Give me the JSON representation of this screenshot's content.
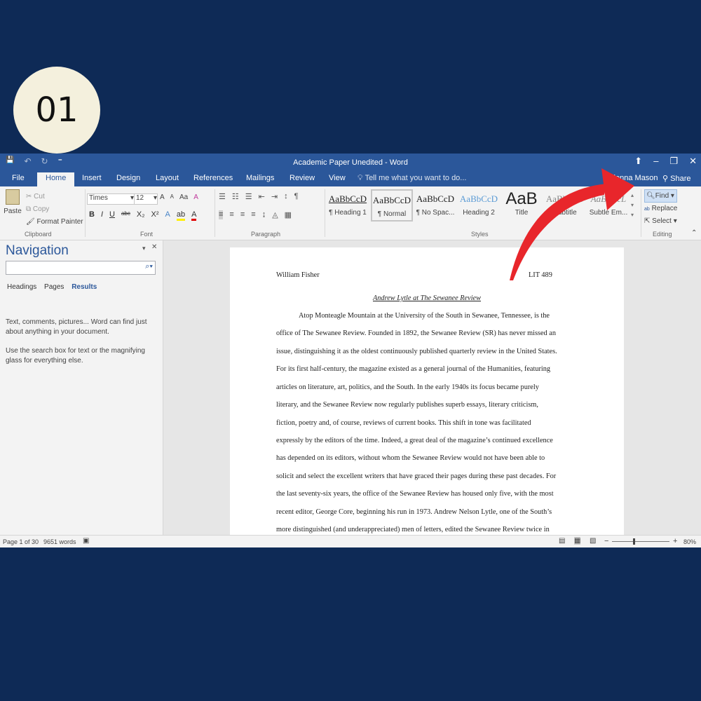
{
  "badge": "01",
  "window": {
    "title": "Academic Paper Unedited - Word",
    "min": "–",
    "restore": "❐",
    "close": "✕",
    "ribbon_opt": "⬆"
  },
  "qat": {
    "save": "💾",
    "undo": "↶",
    "redo": "↻",
    "more": "⁼"
  },
  "tabs": {
    "file": "File",
    "home": "Home",
    "insert": "Insert",
    "design": "Design",
    "layout": "Layout",
    "references": "References",
    "mailings": "Mailings",
    "review": "Review",
    "view": "View",
    "tell": "Tell me what you want to do...",
    "user": "Olenna Mason",
    "share": "Share"
  },
  "clipboard": {
    "paste": "Paste",
    "cut": "Cut",
    "copy": "Copy",
    "format_painter": "Format Painter",
    "label": "Clipboard"
  },
  "font": {
    "name": "Times",
    "size": "12",
    "label": "Font",
    "bold": "B",
    "italic": "I",
    "underline": "U",
    "strike": "abc",
    "sub": "X₂",
    "sup": "X²",
    "case": "Aa",
    "grow": "A",
    "shrink": "A"
  },
  "paragraph": {
    "label": "Paragraph",
    "pilcrow": "¶"
  },
  "styles": {
    "label": "Styles",
    "items": [
      {
        "sample": "AaBbCcD",
        "name": "¶ Heading 1"
      },
      {
        "sample": "AaBbCcD",
        "name": "¶ Normal"
      },
      {
        "sample": "AaBbCcD",
        "name": "¶ No Spac..."
      },
      {
        "sample": "AaBbCcD",
        "name": "Heading 2"
      },
      {
        "sample": "AaB",
        "name": "Title"
      },
      {
        "sample": "AaBbCcD",
        "name": "Subtitle"
      },
      {
        "sample": "AaBbCcL",
        "name": "Subtle Em..."
      }
    ]
  },
  "editing": {
    "find": "Find",
    "replace": "Replace",
    "select": "Select",
    "label": "Editing"
  },
  "navigation": {
    "title": "Navigation",
    "tabs": {
      "headings": "Headings",
      "pages": "Pages",
      "results": "Results"
    },
    "help1": "Text, comments, pictures... Word can find just about anything in your document.",
    "help2": "Use the search box for text or the magnifying glass for everything else."
  },
  "document": {
    "author": "William Fisher",
    "course": "LIT 489",
    "title": "Andrew Lytle at The Sewanee Review",
    "lines": [
      "Atop Monteagle Mountain at the University of the South in Sewanee, Tennessee, is the",
      "office of The Sewanee Review. Founded in 1892, the Sewanee Review (SR) has never missed an",
      "issue, distinguishing it as the oldest continuously published quarterly review in the United States.",
      "For its first half-century, the magazine existed as a general journal of the Humanities, featuring",
      "articles on literature, art, politics, and the South. In the early 1940s its focus became purely",
      "literary, and the Sewanee Review now regularly publishes superb essays, literary criticism,",
      "fiction, poetry and, of course, reviews of current books. This shift in tone was facilitated",
      "expressly by the editors of the time. Indeed, a great deal of the magazine’s continued excellence",
      "has depended on its editors, without whom the Sewanee Review would not have been able to",
      "solicit and select the excellent writers that have graced their pages during these past decades. For",
      "the last seventy-six years, the office of the Sewanee Review has housed only five, with the most",
      "recent editor, George Core, beginning his run in 1973. Andrew Nelson Lytle, one of the South’s",
      "more distinguished (and underappreciated) men of letters, edited the Sewanee Review twice in"
    ]
  },
  "status": {
    "page": "Page 1 of 30",
    "words": "9651 words",
    "zoom": "80%",
    "minus": "−",
    "plus": "+"
  },
  "colors": {
    "brand": "#2b579a",
    "arrow": "#e8262b",
    "background": "#0e2a56",
    "badge": "#f4f0dd"
  }
}
